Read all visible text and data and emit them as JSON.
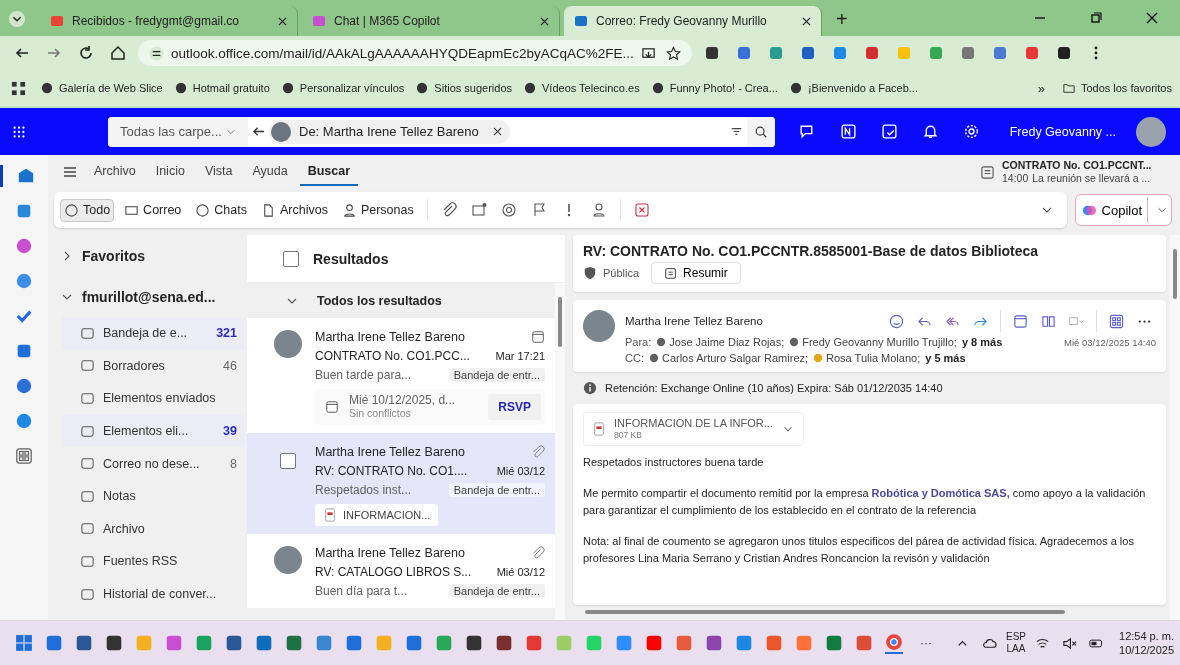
{
  "browser": {
    "tabs": [
      {
        "title": "Recibidos - fredygmt@gmail.co",
        "selected": false
      },
      {
        "title": "Chat | M365 Copilot",
        "selected": false
      },
      {
        "title": "Correo: Fredy Geovanny Murillo",
        "selected": true
      }
    ],
    "new_tab": "+",
    "address": "outlook.office.com/mail/id/AAkALgAAAAAAHYQDEapmEc2byACqAC%2FE...",
    "bookmarks": [
      "Galería de Web Slice",
      "Hotmail gratuito",
      "Personalizar vínculos",
      "Sitios sugeridos",
      "Vídeos Telecinco.es",
      "Funny Photo! - Crea...",
      "¡Bienvenido a Faceb..."
    ],
    "bookmarks_more": "»",
    "all_bookmarks": "Todos los favoritos"
  },
  "header": {
    "scope": "Todas las carpe...",
    "search_chip": "De: Martha Irene Tellez Bareno",
    "user": "Fredy Geovanny ..."
  },
  "ribbon_tabs": [
    {
      "label": "Archivo",
      "selected": false
    },
    {
      "label": "Inicio",
      "selected": false
    },
    {
      "label": "Vista",
      "selected": false
    },
    {
      "label": "Ayuda",
      "selected": false
    },
    {
      "label": "Buscar",
      "selected": true
    }
  ],
  "reminder": {
    "title": "CONTRATO No. CO1.PCCNT...",
    "time": "14:00",
    "text": "La reunión se llevará a ..."
  },
  "filters": [
    {
      "label": "Todo",
      "selected": true
    },
    {
      "label": "Correo",
      "selected": false
    },
    {
      "label": "Chats",
      "selected": false
    },
    {
      "label": "Archivos",
      "selected": false
    },
    {
      "label": "Personas",
      "selected": false
    }
  ],
  "copilot": "Copilot",
  "folders": {
    "favorites": {
      "label": "Favoritos",
      "expanded": false
    },
    "account": {
      "label": "fmurillot@sena.ed...",
      "expanded": true
    },
    "items": [
      {
        "name": "Bandeja de e...",
        "count": "321",
        "unread": true
      },
      {
        "name": "Borradores",
        "count": "46",
        "unread": false
      },
      {
        "name": "Elementos enviados"
      },
      {
        "name": "Elementos eli...",
        "count": "39",
        "unread": true
      },
      {
        "name": "Correo no dese...",
        "count": "8",
        "unread": false
      },
      {
        "name": "Notas"
      },
      {
        "name": "Archivo"
      },
      {
        "name": "Fuentes RSS"
      },
      {
        "name": "Historial de conver..."
      }
    ]
  },
  "results": {
    "title": "Resultados",
    "checked": false,
    "group": "Todos los resultados",
    "messages": [
      {
        "sender": "Martha Irene Tellez Bareno",
        "subject": "CONTRATO No. CO1.PCC...",
        "date": "Mar 17:21",
        "preview": "Buen tarde para...",
        "folder": "Bandeja de entr...",
        "selected": false,
        "kind": "meeting",
        "meeting": {
          "when": "Mié 10/12/2025, d...",
          "status": "Sin conflictos",
          "action": "RSVP"
        }
      },
      {
        "sender": "Martha Irene Tellez Bareno",
        "subject": "RV: CONTRATO No. CO1....",
        "date": "Mié 03/12",
        "preview": "Respetados inst...",
        "folder": "Bandeja de entr...",
        "selected": true,
        "kind": "attachment",
        "attachment": "INFORMACION..."
      },
      {
        "sender": "Martha Irene Tellez Bareno",
        "subject": "RV: CATALOGO LIBROS S...",
        "date": "Mié 03/12",
        "preview": "Buen día para t...",
        "folder": "Bandeja de entr...",
        "selected": false,
        "kind": "attachment"
      }
    ]
  },
  "reading": {
    "subject": "RV: CONTRATO No. CO1.PCCNTR.8585001-Base de datos Biblioteca",
    "sensitivity": "Pública",
    "summarize": "Resumir",
    "sender": "Martha Irene Tellez Bareno",
    "to_label": "Para:",
    "to": [
      {
        "name": "Jose Jaime Diaz Rojas;",
        "color": "#616161"
      },
      {
        "name": "Fredy Geovanny Murillo Trujillo;",
        "color": "#616161"
      }
    ],
    "to_more": "y 8 más",
    "date": "Mié 03/12/2025 14:40",
    "cc_label": "CC:",
    "cc": [
      {
        "name": "Carlos Arturo Salgar Ramirez;",
        "color": "#616161"
      },
      {
        "name": "Rosa Tulia Molano;",
        "color": "#e8a317"
      }
    ],
    "cc_more": "y 5 más",
    "retention": "Retención: Exchange Online (10 años) Expira: Sáb 01/12/2035 14:40",
    "attachment": {
      "name": "INFORMACION DE LA INFOR...",
      "size": "807 KB"
    },
    "body": [
      "Respetados instructores buena tarde",
      "Me permito compartir el documento remitid por la empresa **Robótica y Domótica SAS,** como apoyo a la validación para garantizar el cumplimiento de los establecido en el contrato de la referencia",
      "Nota: al final de coumento se agregaron unos titulos especificos del párea de actividad física. Agradecemos a los profesores Lina Maria Serrano y Cristian Andres Roncancion la revisón y validación"
    ]
  },
  "taskbar": {
    "overflow": "···",
    "lang": "ESP",
    "layout": "LAA",
    "time": "12:54 p. m.",
    "date": "10/12/2025"
  }
}
